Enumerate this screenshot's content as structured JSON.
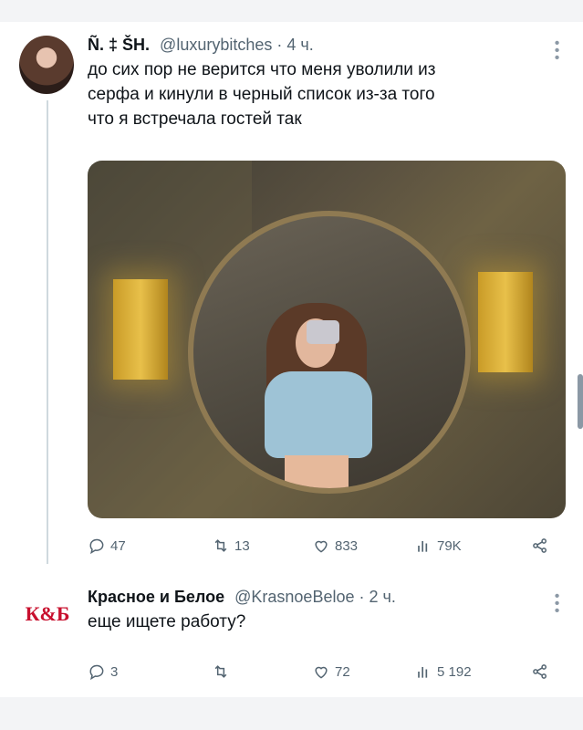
{
  "tweet": {
    "display_name": "Ñ. ‡ ŠH.",
    "handle": "@luxurybitches",
    "separator": "·",
    "time": "4 ч.",
    "text_lines": [
      "до сих пор не верится что меня уволили из",
      "серфа и кинули в черный список из-за того",
      "что я встречала гостей так"
    ],
    "stats": {
      "replies": "47",
      "retweets": "13",
      "likes": "833",
      "views": "79K"
    }
  },
  "reply": {
    "logo_text": "К&Б",
    "display_name": "Красное и Белое",
    "handle": "@KrasnoeBeloe",
    "separator": "·",
    "time": "2 ч.",
    "text": "еще ищете работу?",
    "stats": {
      "replies": "3",
      "retweets": "",
      "likes": "72",
      "views": "5 192"
    }
  },
  "icons": {
    "more": "more-options-icon",
    "reply": "reply-icon",
    "retweet": "retweet-icon",
    "like": "heart-icon",
    "views": "views-bars-icon",
    "share": "share-icon"
  },
  "colors": {
    "text_primary": "#0f1419",
    "text_muted": "#536471",
    "logo_red": "#c8102e",
    "thread_line": "#cfd9de"
  }
}
